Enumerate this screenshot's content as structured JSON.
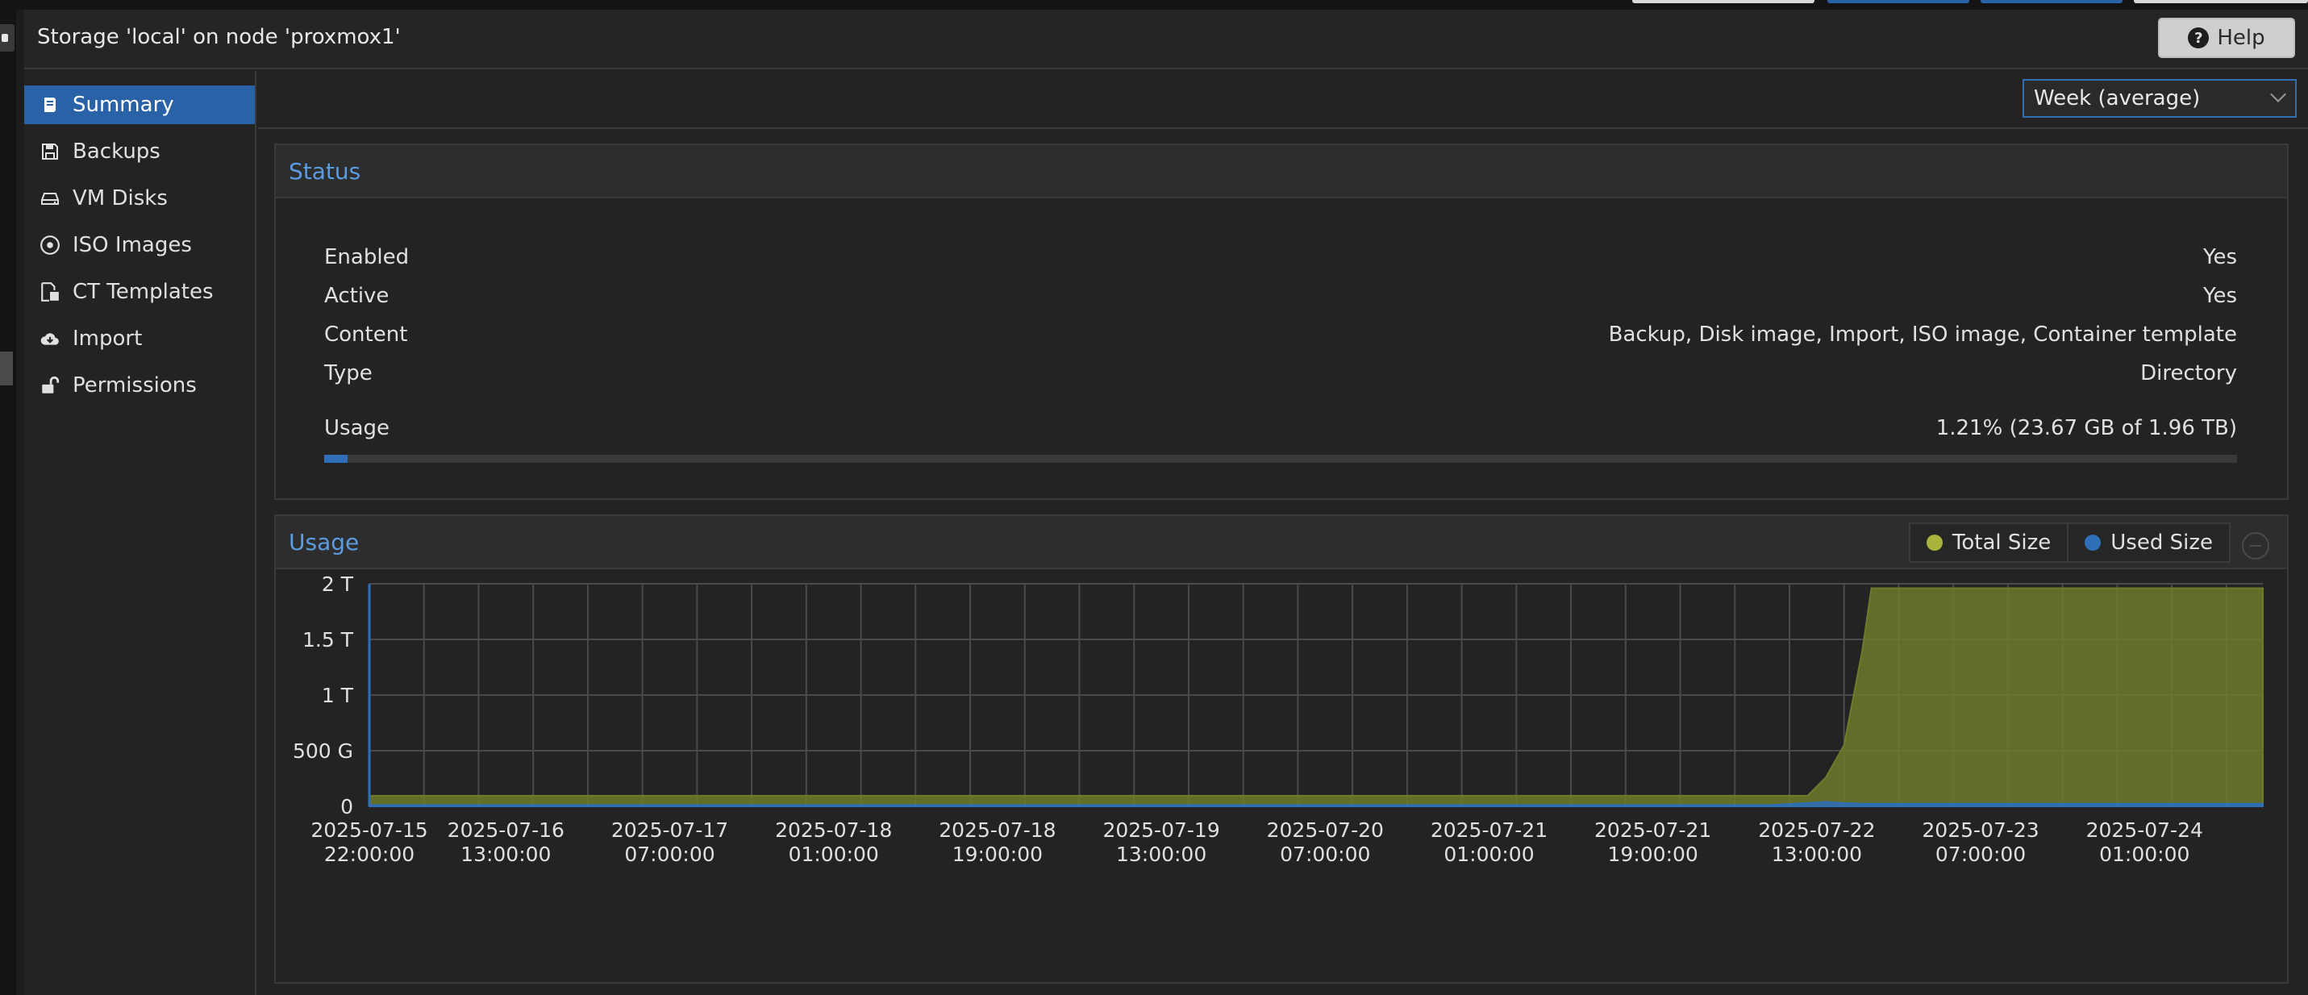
{
  "panel": {
    "title": "Storage 'local' on node 'proxmox1'",
    "help_label": "Help"
  },
  "nav": {
    "items": [
      {
        "label": "Summary",
        "icon": "book-icon",
        "active": true
      },
      {
        "label": "Backups",
        "icon": "floppy-icon"
      },
      {
        "label": "VM Disks",
        "icon": "hdd-icon"
      },
      {
        "label": "ISO Images",
        "icon": "disc-icon"
      },
      {
        "label": "CT Templates",
        "icon": "file-cube-icon"
      },
      {
        "label": "Import",
        "icon": "cloud-download-icon"
      },
      {
        "label": "Permissions",
        "icon": "unlock-icon"
      }
    ]
  },
  "timeframe": {
    "selected": "Week (average)"
  },
  "status": {
    "title": "Status",
    "rows": [
      {
        "key": "Enabled",
        "value": "Yes"
      },
      {
        "key": "Active",
        "value": "Yes"
      },
      {
        "key": "Content",
        "value": "Backup, Disk image, Import, ISO image, Container template"
      },
      {
        "key": "Type",
        "value": "Directory"
      }
    ],
    "usage": {
      "key": "Usage",
      "value": "1.21% (23.67 GB of 1.96 TB)",
      "percent": 1.21
    }
  },
  "usage_chart": {
    "title": "Usage",
    "legend": [
      {
        "name": "Total Size",
        "color": "#a8b43a"
      },
      {
        "name": "Used Size",
        "color": "#2f6fb7"
      }
    ]
  },
  "colors": {
    "accent": "#2962a6",
    "section_title": "#5b9be0",
    "total_fill": "#6f7a2b",
    "used_fill": "#2f6fb7"
  },
  "chart_data": {
    "type": "area",
    "ylabel": "",
    "xlabel": "",
    "ylim": [
      0,
      2
    ],
    "y_ticks": [
      {
        "value": 0,
        "label": "0"
      },
      {
        "value": 0.5,
        "label": "500 G"
      },
      {
        "value": 1,
        "label": "1 T"
      },
      {
        "value": 1.5,
        "label": "1.5 T"
      },
      {
        "value": 2,
        "label": "2 T"
      }
    ],
    "x_ticks": [
      {
        "t": 0,
        "line1": "2025-07-15",
        "line2": "22:00:00"
      },
      {
        "t": 15,
        "line1": "2025-07-16",
        "line2": "13:00:00"
      },
      {
        "t": 33,
        "line1": "2025-07-17",
        "line2": "07:00:00"
      },
      {
        "t": 51,
        "line1": "2025-07-18",
        "line2": "01:00:00"
      },
      {
        "t": 69,
        "line1": "2025-07-18",
        "line2": "19:00:00"
      },
      {
        "t": 87,
        "line1": "2025-07-19",
        "line2": "13:00:00"
      },
      {
        "t": 105,
        "line1": "2025-07-20",
        "line2": "07:00:00"
      },
      {
        "t": 123,
        "line1": "2025-07-21",
        "line2": "01:00:00"
      },
      {
        "t": 141,
        "line1": "2025-07-21",
        "line2": "19:00:00"
      },
      {
        "t": 159,
        "line1": "2025-07-22",
        "line2": "13:00:00"
      },
      {
        "t": 177,
        "line1": "2025-07-23",
        "line2": "07:00:00"
      },
      {
        "t": 195,
        "line1": "2025-07-24",
        "line2": "01:00:00"
      }
    ],
    "x_range_hours": [
      0,
      208
    ],
    "series": [
      {
        "name": "Total Size",
        "points": [
          [
            0,
            0.095
          ],
          [
            158,
            0.095
          ],
          [
            160,
            0.26
          ],
          [
            162,
            0.55
          ],
          [
            164,
            1.4
          ],
          [
            165,
            1.96
          ],
          [
            208,
            1.96
          ]
        ]
      },
      {
        "name": "Used Size",
        "points": [
          [
            0,
            0.012
          ],
          [
            154,
            0.012
          ],
          [
            158,
            0.03
          ],
          [
            160,
            0.04
          ],
          [
            162,
            0.03
          ],
          [
            164,
            0.024
          ],
          [
            208,
            0.024
          ]
        ]
      }
    ]
  }
}
